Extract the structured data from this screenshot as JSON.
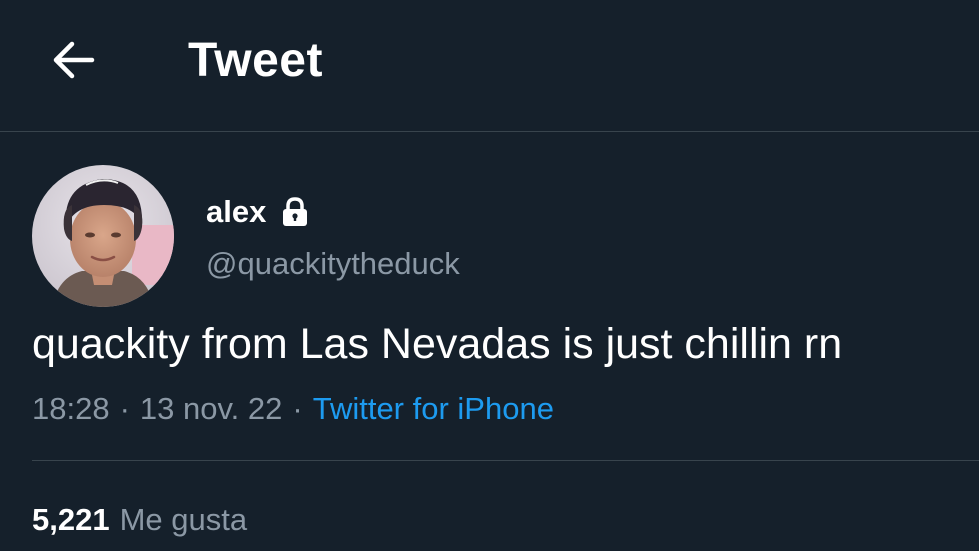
{
  "header": {
    "title": "Tweet",
    "back_icon": "arrow-left-icon"
  },
  "author": {
    "display_name": "alex",
    "handle": "@quackitytheduck",
    "protected_icon": "lock-icon",
    "avatar_icon": "user-avatar"
  },
  "tweet": {
    "text": "quackity from Las Nevadas is just chillin rn",
    "time": "18:28",
    "date": "13 nov. 22",
    "separator": "·",
    "source": "Twitter for iPhone"
  },
  "stats": {
    "likes_count": "5,221",
    "likes_label": "Me gusta"
  },
  "colors": {
    "background": "#15202b",
    "divider": "#38444d",
    "secondary_text": "#8b98a5",
    "link": "#1d9bf0"
  }
}
